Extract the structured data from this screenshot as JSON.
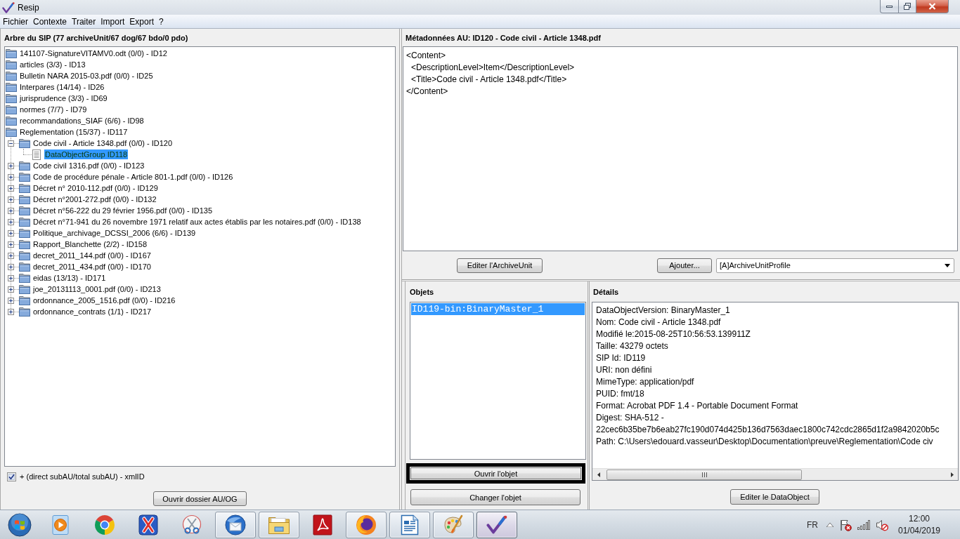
{
  "window": {
    "title": "Resip"
  },
  "menu": [
    "Fichier",
    "Contexte",
    "Traiter",
    "Import",
    "Export",
    "?"
  ],
  "tree_panel": {
    "title": "Arbre du SIP (77 archiveUnit/67 dog/67 bdo/0 pdo)",
    "items": [
      {
        "label": "141107-SignatureVITAMV0.odt (0/0) - ID12",
        "kind": "folder",
        "selected": false
      },
      {
        "label": "articles (3/3) - ID13",
        "kind": "folder",
        "selected": false
      },
      {
        "label": "Bulletin NARA 2015-03.pdf (0/0) - ID25",
        "kind": "folder",
        "selected": false
      },
      {
        "label": "Interpares (14/14) - ID26",
        "kind": "folder",
        "selected": false
      },
      {
        "label": "jurisprudence (3/3) - ID69",
        "kind": "folder",
        "selected": false
      },
      {
        "label": "normes (7/7) - ID79",
        "kind": "folder",
        "selected": false
      },
      {
        "label": "recommandations_SIAF (6/6) - ID98",
        "kind": "folder",
        "selected": false
      },
      {
        "label": "Reglementation (15/37) - ID117",
        "kind": "folder",
        "selected": false,
        "children": [
          {
            "label": "Code civil - Article 1348.pdf (0/0) - ID120",
            "kind": "folder",
            "selected": false,
            "expanded": true,
            "children": [
              {
                "label": "DataObjectGroup ID118",
                "kind": "object",
                "selected": true
              }
            ]
          },
          {
            "label": "Code civil 1316.pdf (0/0) - ID123",
            "kind": "folder",
            "selected": false,
            "expanded": false
          },
          {
            "label": "Code de procédure pénale - Article 801-1.pdf (0/0) - ID126",
            "kind": "folder",
            "selected": false,
            "expanded": false
          },
          {
            "label": "Décret n° 2010-112.pdf (0/0) - ID129",
            "kind": "folder",
            "selected": false,
            "expanded": false
          },
          {
            "label": "Décret n°2001-272.pdf (0/0) - ID132",
            "kind": "folder",
            "selected": false,
            "expanded": false
          },
          {
            "label": "Décret n°56-222 du 29 février 1956.pdf (0/0) - ID135",
            "kind": "folder",
            "selected": false,
            "expanded": false
          },
          {
            "label": "Décret n°71-941 du 26 novembre 1971 relatif aux actes établis par les notaires.pdf (0/0) - ID138",
            "kind": "folder",
            "selected": false,
            "expanded": false
          },
          {
            "label": "Politique_archivage_DCSSI_2006 (6/6) - ID139",
            "kind": "folder",
            "selected": false,
            "expanded": false
          },
          {
            "label": "Rapport_Blanchette (2/2) - ID158",
            "kind": "folder",
            "selected": false,
            "expanded": false
          },
          {
            "label": "decret_2011_144.pdf (0/0) - ID167",
            "kind": "folder",
            "selected": false,
            "expanded": false
          },
          {
            "label": "decret_2011_434.pdf (0/0) - ID170",
            "kind": "folder",
            "selected": false,
            "expanded": false
          },
          {
            "label": "eidas (13/13) - ID171",
            "kind": "folder",
            "selected": false,
            "expanded": false
          },
          {
            "label": "joe_20131113_0001.pdf (0/0) - ID213",
            "kind": "folder",
            "selected": false,
            "expanded": false
          },
          {
            "label": "ordonnance_2005_1516.pdf (0/0) - ID216",
            "kind": "folder",
            "selected": false,
            "expanded": false
          },
          {
            "label": "ordonnance_contrats (1/1) - ID217",
            "kind": "folder",
            "selected": false,
            "expanded": false
          }
        ]
      }
    ],
    "option": {
      "label": "+ (direct subAU/total subAU) - xmlID",
      "checked": true
    },
    "button": "Ouvrir dossier AU/OG"
  },
  "metadata_panel": {
    "title": "Métadonnées AU: ID120 - Code civil - Article 1348.pdf",
    "xml": [
      {
        "line": "<Content>",
        "children": [
          {
            "line": "<DescriptionLevel>Item</DescriptionLevel>"
          },
          {
            "line": "<Title>Code civil - Article 1348.pdf</Title>"
          }
        ]
      },
      {
        "line": "</Content>"
      }
    ],
    "edit_button": "Editer l'ArchiveUnit",
    "add_button": "Ajouter...",
    "profile_select": {
      "value": "[A]ArchiveUnitProfile"
    }
  },
  "objects_panel": {
    "title": "Objets",
    "items": [
      {
        "label": "ID119-bin:BinaryMaster_1",
        "selected": true
      }
    ],
    "buttons": [
      {
        "label": "Ouvrir l'objet",
        "focused": true
      },
      {
        "label": "Changer l'objet",
        "focused": false
      }
    ]
  },
  "details_panel": {
    "title": "Détails",
    "lines": [
      "DataObjectVersion: BinaryMaster_1",
      "Nom: Code civil - Article 1348.pdf",
      "Modifié le:2015-08-25T10:56:53.139911Z",
      "Taille: 43279 octets",
      "SIP Id: ID119",
      "URI: non défini",
      "MimeType: application/pdf",
      "PUID: fmt/18",
      "Format: Acrobat PDF 1.4 - Portable Document Format",
      "Digest: SHA-512 -",
      "22cec6b35be7b6eab27fc190d074d425b136d7563daec1800c742cdc2865d1f2a9842020b5c",
      "Path: C:\\Users\\edouard.vasseur\\Desktop\\Documentation\\preuve\\Reglementation\\Code civ"
    ],
    "button": "Editer le DataObject"
  },
  "taskbar": {
    "items": [
      {
        "open": false,
        "selected": false
      },
      {
        "open": false,
        "selected": false
      },
      {
        "open": false,
        "selected": false
      },
      {
        "open": false,
        "selected": false
      },
      {
        "open": true,
        "selected": false
      },
      {
        "open": true,
        "selected": false
      },
      {
        "open": false,
        "selected": false
      },
      {
        "open": true,
        "selected": false
      },
      {
        "open": true,
        "selected": false
      },
      {
        "open": true,
        "selected": false
      },
      {
        "open": true,
        "selected": true
      }
    ],
    "language": "FR",
    "time": "12:00",
    "date": "01/04/2019"
  }
}
